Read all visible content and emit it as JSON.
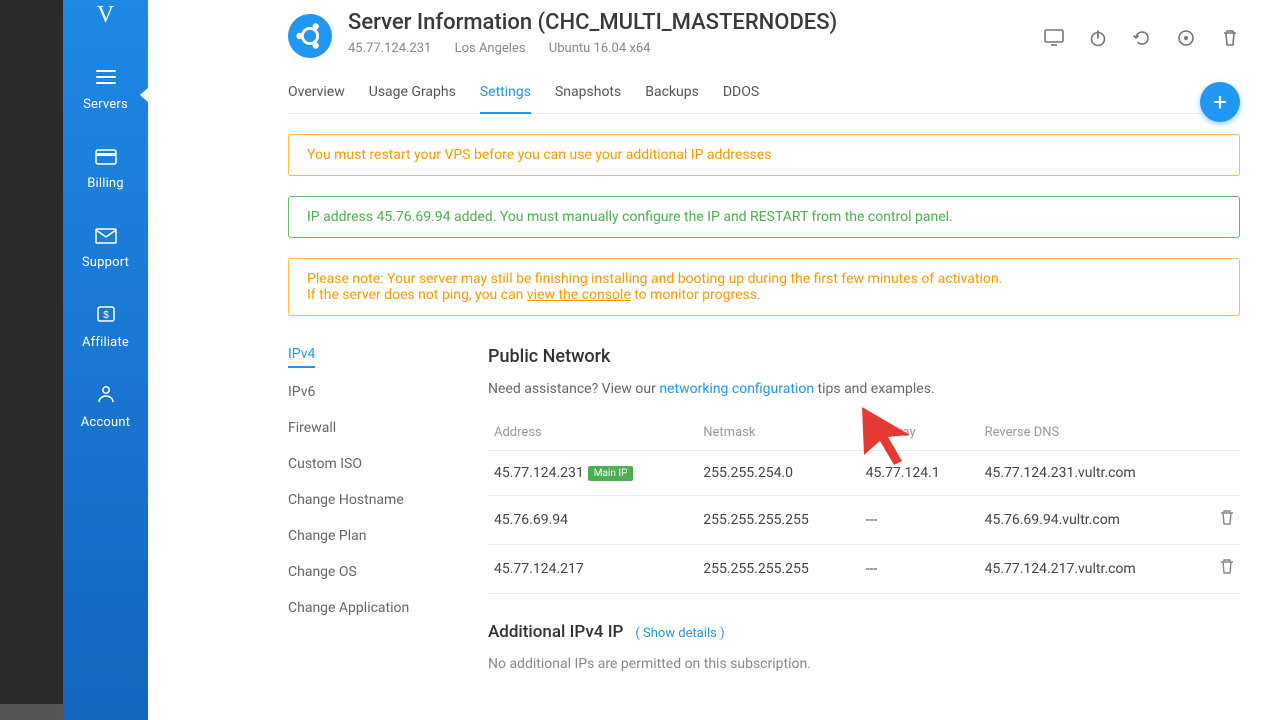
{
  "sidebar": {
    "items": [
      {
        "label": "Servers"
      },
      {
        "label": "Billing"
      },
      {
        "label": "Support"
      },
      {
        "label": "Affiliate"
      },
      {
        "label": "Account"
      }
    ]
  },
  "header": {
    "title": "Server Information (CHC_MULTI_MASTERNODES)",
    "ip": "45.77.124.231",
    "location": "Los Angeles",
    "os": "Ubuntu 16.04 x64"
  },
  "tabs": [
    {
      "label": "Overview"
    },
    {
      "label": "Usage Graphs"
    },
    {
      "label": "Settings"
    },
    {
      "label": "Snapshots"
    },
    {
      "label": "Backups"
    },
    {
      "label": "DDOS"
    }
  ],
  "alerts": {
    "restart": "You must restart your VPS before you can use your additional IP addresses",
    "added": "IP address 45.76.69.94 added. You must manually configure the IP and RESTART from the control panel.",
    "note1": "Please note: Your server may still be finishing installing and booting up during the first few minutes of activation.",
    "note2a": "If the server does not ping, you can ",
    "note2link": "view the console",
    "note2b": " to monitor progress."
  },
  "settings_nav": [
    {
      "label": "IPv4"
    },
    {
      "label": "IPv6"
    },
    {
      "label": "Firewall"
    },
    {
      "label": "Custom ISO"
    },
    {
      "label": "Change Hostname"
    },
    {
      "label": "Change Plan"
    },
    {
      "label": "Change OS"
    },
    {
      "label": "Change Application"
    }
  ],
  "public_network": {
    "heading": "Public Network",
    "assist_prefix": "Need assistance? View our ",
    "assist_link": "networking configuration",
    "assist_suffix": " tips and examples.",
    "cols": {
      "address": "Address",
      "netmask": "Netmask",
      "gateway": "Gateway",
      "rdns": "Reverse DNS"
    },
    "main_ip_badge": "Main IP",
    "rows": [
      {
        "address": "45.77.124.231",
        "netmask": "255.255.254.0",
        "gateway": "45.77.124.1",
        "rdns": "45.77.124.231.vultr.com",
        "main": true,
        "deletable": false
      },
      {
        "address": "45.76.69.94",
        "netmask": "255.255.255.255",
        "gateway": "---",
        "rdns": "45.76.69.94.vultr.com",
        "main": false,
        "deletable": true
      },
      {
        "address": "45.77.124.217",
        "netmask": "255.255.255.255",
        "gateway": "---",
        "rdns": "45.77.124.217.vultr.com",
        "main": false,
        "deletable": true
      }
    ]
  },
  "additional": {
    "heading": "Additional IPv4 IP",
    "show_details": "( Show details )",
    "empty": "No additional IPs are permitted on this subscription."
  }
}
